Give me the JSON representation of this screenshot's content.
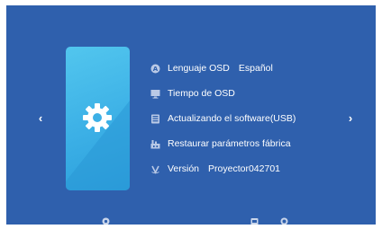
{
  "menu": {
    "items": [
      {
        "label": "Lenguaje OSD",
        "value": "Español",
        "icon": "language-icon"
      },
      {
        "label": "Tiempo de OSD",
        "value": "",
        "icon": "monitor-timer-icon"
      },
      {
        "label": "Actualizando el software(USB)",
        "value": "",
        "icon": "usb-update-icon"
      },
      {
        "label": "Restaurar parámetros fábrica",
        "value": "",
        "icon": "factory-reset-icon"
      },
      {
        "label": "Versión",
        "value": "Proyector042701",
        "icon": "version-icon"
      }
    ]
  },
  "navigation": {
    "prev_label": "‹",
    "next_label": "›"
  },
  "card": {
    "icon": "settings-gear-icon"
  },
  "bottom_bar": {
    "icons": [
      "settings-icon",
      "input-source-icon",
      "display-icon"
    ]
  },
  "colors": {
    "background": "#2f60ad",
    "card_top": "#52c6ee",
    "card_bottom": "#2b9fdc",
    "text": "#ffffff",
    "icon": "#b9c9e6"
  }
}
